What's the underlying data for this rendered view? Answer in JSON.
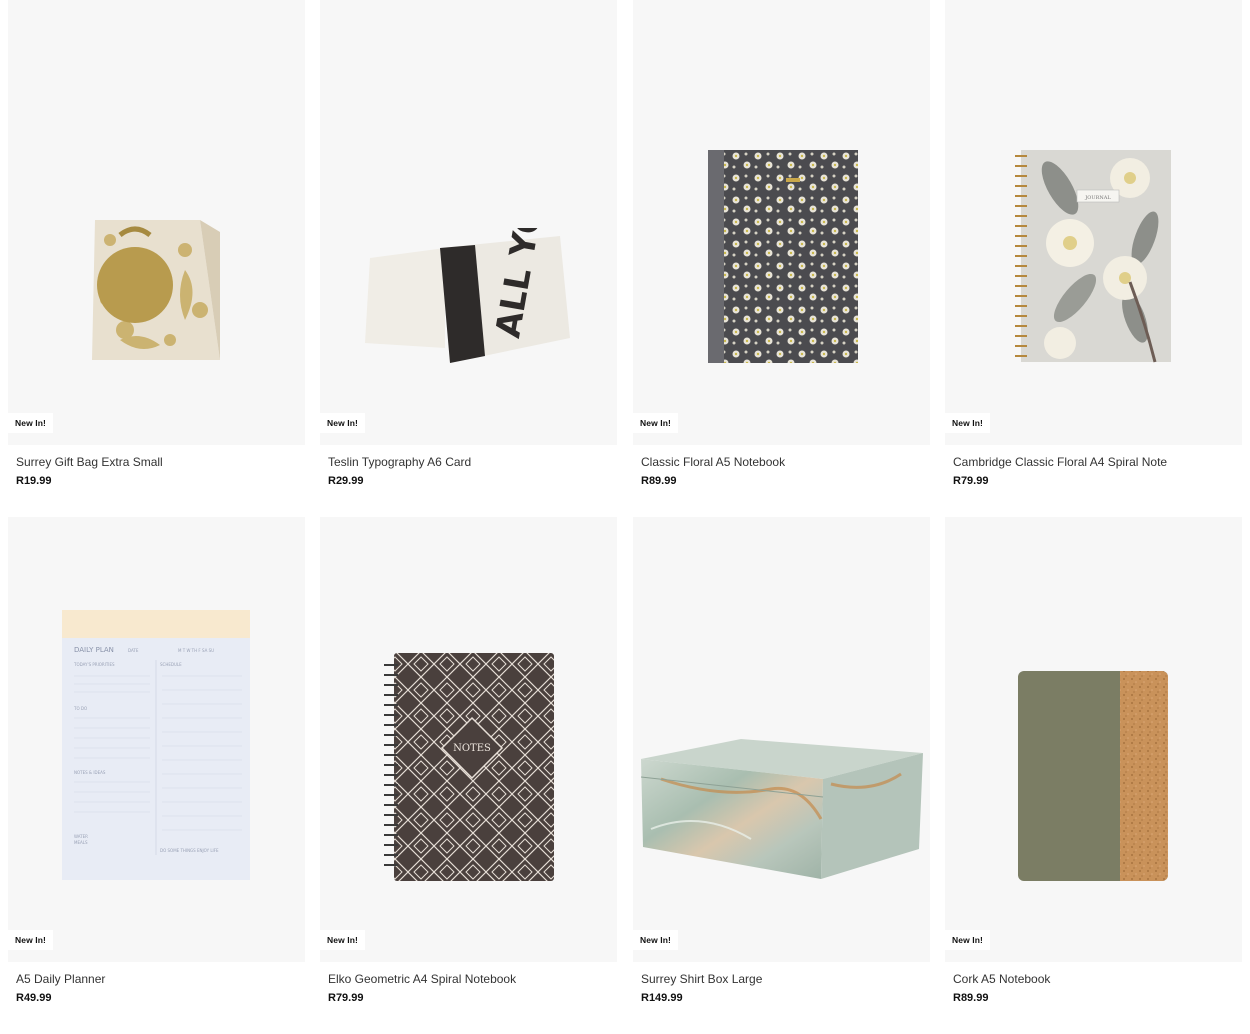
{
  "badge_text": "New In!",
  "products": [
    {
      "name": "Surrey Gift Bag Extra Small",
      "price": "R19.99",
      "image": "gold-floral-gift-bag"
    },
    {
      "name": "Teslin Typography A6 Card",
      "price": "R29.99",
      "image": "all-yours-card"
    },
    {
      "name": "Classic Floral A5 Notebook",
      "price": "R89.99",
      "image": "floral-notebook"
    },
    {
      "name": "Cambridge Classic Floral A4 Spiral Note",
      "price": "R79.99",
      "image": "magnolia-spiral-journal"
    },
    {
      "name": "A5 Daily Planner",
      "price": "R49.99",
      "image": "daily-planner-pad"
    },
    {
      "name": "Elko Geometric A4 Spiral Notebook",
      "price": "R79.99",
      "image": "geometric-notes-notebook"
    },
    {
      "name": "Surrey Shirt Box Large",
      "price": "R149.99",
      "image": "marble-shirt-box"
    },
    {
      "name": "Cork A5 Notebook",
      "price": "R89.99",
      "image": "cork-notebook"
    }
  ],
  "image_text": {
    "card": "ALL YOURS",
    "journal": "JOURNAL",
    "planner_title": "DAILY PLAN",
    "planner_date": "DATE",
    "planner_days": "M T W TH F SA SU",
    "planner_priorities": "TODAY'S PRIORITIES",
    "planner_schedule": "SCHEDULE",
    "planner_todo": "TO DO",
    "planner_notes": "NOTES & IDEAS",
    "planner_water": "WATER",
    "planner_meals": "MEALS",
    "planner_footer": "DO SOME THINGS ENJOY LIFE",
    "notes": "NOTES"
  }
}
